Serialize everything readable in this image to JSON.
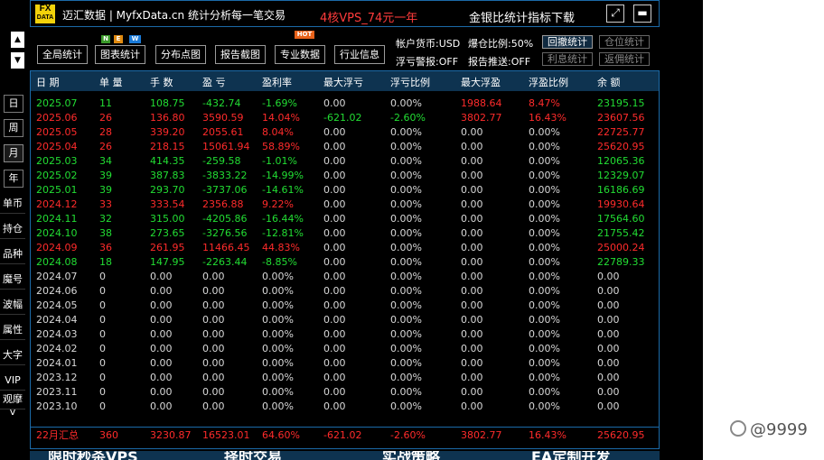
{
  "title_bar": {
    "logo_line1": "FX",
    "logo_line2": "DATA",
    "title": "迈汇数据 | MyfxData.cn  统计分析每一笔交易",
    "promo": "4核VPS_74元一年",
    "link": "金银比统计指标下载",
    "resize_glyph": "⤢",
    "menu_glyph": "▬"
  },
  "side": {
    "up_glyph": "▲",
    "down_glyph": "▼",
    "period_buttons": [
      "日",
      "周",
      "月",
      "年"
    ],
    "active_period": "月",
    "menu_items": [
      "单币",
      "持仓",
      "品种",
      "魔号",
      "波幅",
      "属性",
      "大字",
      "VIP",
      "观摩"
    ],
    "more_glyph": "v"
  },
  "toolbar": {
    "buttons": [
      {
        "label": "全局统计"
      },
      {
        "label": "图表统计",
        "badges": [
          "N",
          "E",
          "W"
        ]
      },
      {
        "label": "分布点图"
      },
      {
        "label": "报告截图"
      },
      {
        "label": "专业数据",
        "hot": "HOT"
      },
      {
        "label": "行业信息"
      }
    ],
    "account_currency": "帐户货币:USD",
    "leverage_ratio": "爆仓比例:50%",
    "float_warning": "浮亏警报:OFF",
    "report_push": "报告推送:OFF",
    "stat_buttons": [
      "回撤统计",
      "仓位统计",
      "利息统计",
      "返佣统计"
    ]
  },
  "table": {
    "headers": [
      "日 期",
      "单 量",
      "手 数",
      "盈 亏",
      "盈利率",
      "最大浮亏",
      "浮亏比例",
      "最大浮盈",
      "浮盈比例",
      "余 额"
    ],
    "rows": [
      {
        "color": "green",
        "cells": [
          "2025.07",
          "11",
          "108.75",
          "-432.74",
          "-1.69%",
          "0.00",
          "0.00%",
          "1988.64",
          "8.47%",
          "23195.15"
        ],
        "pnl": "neg"
      },
      {
        "color": "red",
        "cells": [
          "2025.06",
          "26",
          "136.80",
          "3590.59",
          "14.04%",
          "-621.02",
          "-2.60%",
          "3802.77",
          "16.43%",
          "23607.56"
        ],
        "pnl": "pos"
      },
      {
        "color": "red",
        "cells": [
          "2025.05",
          "28",
          "339.20",
          "2055.61",
          "8.04%",
          "0.00",
          "0.00%",
          "0.00",
          "0.00%",
          "22725.77"
        ],
        "pnl": "pos"
      },
      {
        "color": "red",
        "cells": [
          "2025.04",
          "26",
          "218.15",
          "15061.94",
          "58.89%",
          "0.00",
          "0.00%",
          "0.00",
          "0.00%",
          "25620.95"
        ],
        "pnl": "pos"
      },
      {
        "color": "green",
        "cells": [
          "2025.03",
          "34",
          "414.35",
          "-259.58",
          "-1.01%",
          "0.00",
          "0.00%",
          "0.00",
          "0.00%",
          "12065.36"
        ],
        "pnl": "neg"
      },
      {
        "color": "green",
        "cells": [
          "2025.02",
          "39",
          "387.83",
          "-3833.22",
          "-14.99%",
          "0.00",
          "0.00%",
          "0.00",
          "0.00%",
          "12329.07"
        ],
        "pnl": "neg"
      },
      {
        "color": "green",
        "cells": [
          "2025.01",
          "39",
          "293.70",
          "-3737.06",
          "-14.61%",
          "0.00",
          "0.00%",
          "0.00",
          "0.00%",
          "16186.69"
        ],
        "pnl": "neg"
      },
      {
        "color": "red",
        "cells": [
          "2024.12",
          "33",
          "333.54",
          "2356.88",
          "9.22%",
          "0.00",
          "0.00%",
          "0.00",
          "0.00%",
          "19930.64"
        ],
        "pnl": "pos"
      },
      {
        "color": "green",
        "cells": [
          "2024.11",
          "32",
          "315.00",
          "-4205.86",
          "-16.44%",
          "0.00",
          "0.00%",
          "0.00",
          "0.00%",
          "17564.60"
        ],
        "pnl": "neg"
      },
      {
        "color": "green",
        "cells": [
          "2024.10",
          "38",
          "273.65",
          "-3276.56",
          "-12.81%",
          "0.00",
          "0.00%",
          "0.00",
          "0.00%",
          "21755.42"
        ],
        "pnl": "neg"
      },
      {
        "color": "red",
        "cells": [
          "2024.09",
          "36",
          "261.95",
          "11466.45",
          "44.83%",
          "0.00",
          "0.00%",
          "0.00",
          "0.00%",
          "25000.24"
        ],
        "pnl": "pos"
      },
      {
        "color": "green",
        "cells": [
          "2024.08",
          "18",
          "147.95",
          "-2263.44",
          "-8.85%",
          "0.00",
          "0.00%",
          "0.00",
          "0.00%",
          "22789.33"
        ],
        "pnl": "neg"
      },
      {
        "color": "white",
        "cells": [
          "2024.07",
          "0",
          "0.00",
          "0.00",
          "0.00%",
          "0.00",
          "0.00%",
          "0.00",
          "0.00%",
          "0.00"
        ]
      },
      {
        "color": "white",
        "cells": [
          "2024.06",
          "0",
          "0.00",
          "0.00",
          "0.00%",
          "0.00",
          "0.00%",
          "0.00",
          "0.00%",
          "0.00"
        ]
      },
      {
        "color": "white",
        "cells": [
          "2024.05",
          "0",
          "0.00",
          "0.00",
          "0.00%",
          "0.00",
          "0.00%",
          "0.00",
          "0.00%",
          "0.00"
        ]
      },
      {
        "color": "white",
        "cells": [
          "2024.04",
          "0",
          "0.00",
          "0.00",
          "0.00%",
          "0.00",
          "0.00%",
          "0.00",
          "0.00%",
          "0.00"
        ]
      },
      {
        "color": "white",
        "cells": [
          "2024.03",
          "0",
          "0.00",
          "0.00",
          "0.00%",
          "0.00",
          "0.00%",
          "0.00",
          "0.00%",
          "0.00"
        ]
      },
      {
        "color": "white",
        "cells": [
          "2024.02",
          "0",
          "0.00",
          "0.00",
          "0.00%",
          "0.00",
          "0.00%",
          "0.00",
          "0.00%",
          "0.00"
        ]
      },
      {
        "color": "white",
        "cells": [
          "2024.01",
          "0",
          "0.00",
          "0.00",
          "0.00%",
          "0.00",
          "0.00%",
          "0.00",
          "0.00%",
          "0.00"
        ]
      },
      {
        "color": "white",
        "cells": [
          "2023.12",
          "0",
          "0.00",
          "0.00",
          "0.00%",
          "0.00",
          "0.00%",
          "0.00",
          "0.00%",
          "0.00"
        ]
      },
      {
        "color": "white",
        "cells": [
          "2023.11",
          "0",
          "0.00",
          "0.00",
          "0.00%",
          "0.00",
          "0.00%",
          "0.00",
          "0.00%",
          "0.00"
        ]
      },
      {
        "color": "white",
        "cells": [
          "2023.10",
          "0",
          "0.00",
          "0.00",
          "0.00%",
          "0.00",
          "0.00%",
          "0.00",
          "0.00%",
          "0.00"
        ]
      }
    ],
    "summary": [
      "22月汇总",
      "360",
      "3230.87",
      "16523.01",
      "64.60%",
      "-621.02",
      "-2.60%",
      "3802.77",
      "16.43%",
      "25620.95"
    ]
  },
  "banner": [
    "限时秒杀VPS",
    "择时交易",
    "实战策略",
    "EA定制开发"
  ],
  "watermark": "@9999"
}
